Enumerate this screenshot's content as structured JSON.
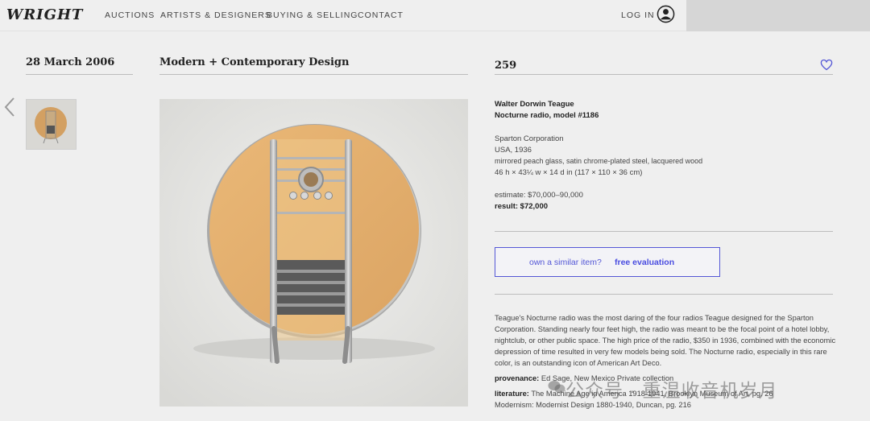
{
  "nav": {
    "logo": "WRIGHT",
    "links": [
      "AUCTIONS",
      "ARTISTS & DESIGNERS",
      "BUYING & SELLING",
      "CONTACT"
    ],
    "login": "LOG IN"
  },
  "auction": {
    "date": "28 March 2006",
    "title": "Modern + Contemporary Design"
  },
  "lot": {
    "number": "259",
    "designer": "Walter Dorwin Teague",
    "item": "Nocturne radio, model #1186",
    "maker": "Sparton Corporation",
    "origin": "USA, 1936",
    "materials": "mirrored peach glass, satin chrome-plated steel, lacquered wood",
    "dimensions": "46 h × 43¼ w × 14 d in (117 × 110 × 36 cm)",
    "estimate": "estimate: $70,000–90,000",
    "result": "result: $72,000"
  },
  "evaluation": {
    "question": "own a similar item?",
    "link": "free evaluation"
  },
  "description": {
    "text": "Teague's Nocturne radio was the most daring of the four radios Teague designed for the Sparton Corporation. Standing nearly four feet high, the radio was meant to be the focal point of a hotel lobby, nightclub, or other public space. The high price of the radio, $350 in 1936, combined with the economic depression of time resulted in very few models being sold. The Nocturne radio, especially in this rare color, is an outstanding icon of American Art Deco.",
    "provenance_label": "provenance:",
    "provenance": "Ed Sage, New Mexico Private collection",
    "literature_label": "literature:",
    "literature_1": "The Machine Age in America 1918-1941, Brooklyn Museum of Art, pg. 26",
    "literature_2": "Modernism: Modernist Design 1880-1940, Duncan, pg. 216"
  },
  "watermark": "公众号 · 重温收音机岁月",
  "colors": {
    "accent": "#5457d6",
    "radio_peach": "#e4ad6c",
    "background": "#efefef"
  },
  "icons": [
    "user-icon",
    "heart-icon",
    "chevron-left-icon",
    "wechat-icon"
  ]
}
